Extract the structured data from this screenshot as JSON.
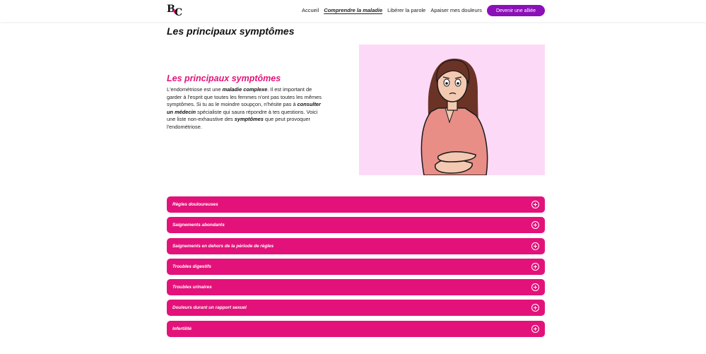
{
  "nav": {
    "logo_letters": [
      "B",
      "C"
    ],
    "links": [
      {
        "label": "Accueil",
        "active": false
      },
      {
        "label": "Comprendre la maladie",
        "active": true
      },
      {
        "label": "Libérer la parole",
        "active": false
      },
      {
        "label": "Apaiser mes douleurs",
        "active": false
      }
    ],
    "cta_label": "Devenir une alliée"
  },
  "page_title": "Les principaux symptômes",
  "intro": {
    "title": "Les principaux symptômes",
    "text_1": "L'endométriose est une ",
    "em_1": "maladie complexe",
    "text_2": ". Il est important de garder à l'esprit que toutes les femmes n'ont pas toutes les mêmes symptômes. Si tu as le moindre soupçon, n'hésite pas à ",
    "em_2": "consulter un médecin",
    "text_3": " spécialiste qui saura répondre à tes questions. Voici une liste non-exhaustive des ",
    "em_3": "symptômes",
    "text_4": " que peut provoquer l'endométriose."
  },
  "illustration": {
    "background": "#fcdaf7",
    "subject": "woman-holding-stomach-illustration"
  },
  "accordion": {
    "items": [
      "Règles douloureuses",
      "Saignements abondants",
      "Saignements en dehors de la période de règles",
      "Troubles digestifs",
      "Troubles urinaires",
      "Douleurs durant un rapport sexuel",
      "Infertilité"
    ],
    "icon": "plus-circle-icon"
  },
  "colors": {
    "accent_pink": "#e3127a",
    "cta_purple": "#8b10b8",
    "illustration_bg": "#fcdaf7"
  }
}
